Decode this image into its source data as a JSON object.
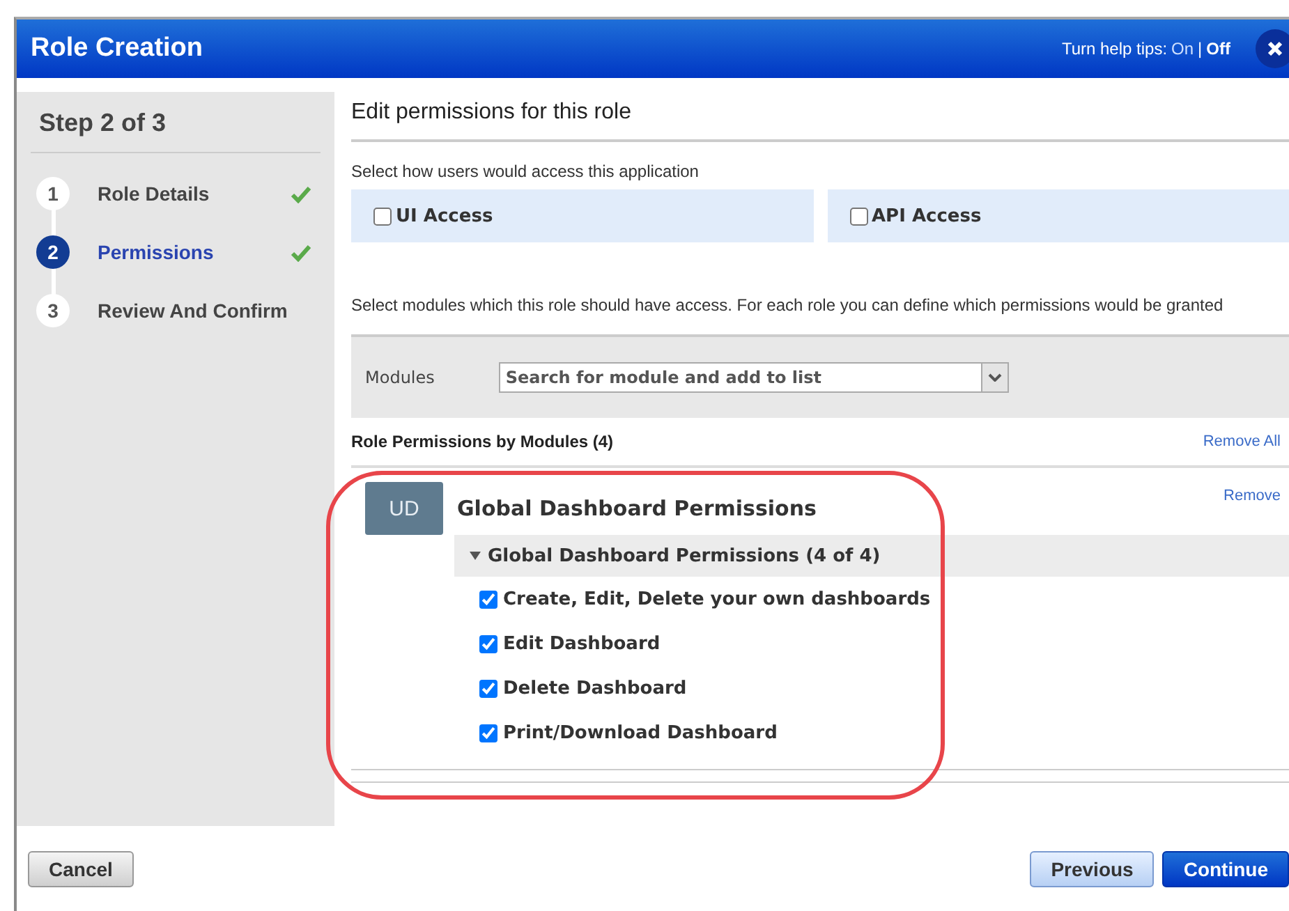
{
  "window": {
    "title": "Role Creation"
  },
  "help_tips": {
    "label": "Turn help tips:",
    "separator": "|",
    "options": [
      {
        "label": "On",
        "selected": false
      },
      {
        "label": "Off",
        "selected": true
      }
    ]
  },
  "sidebar": {
    "title": "Step 2 of 3",
    "steps": [
      {
        "number": "1",
        "label": "Role Details",
        "selected": false,
        "completed": true
      },
      {
        "number": "2",
        "label": "Permissions",
        "selected": true,
        "completed": true
      },
      {
        "number": "3",
        "label": "Review And Confirm",
        "selected": false,
        "completed": false
      }
    ]
  },
  "content": {
    "heading": "Edit permissions for this role",
    "access_prompt": "Select how users would access this application",
    "access_options": [
      {
        "label": "UI Access",
        "checked": false
      },
      {
        "label": "API Access",
        "checked": false
      }
    ],
    "modules_prompt": "Select modules which this role should have access. For each role you can define which permissions would be granted",
    "modules_label": "Modules",
    "modules_placeholder": "Search for module and add to list",
    "permissions_title": "Role Permissions by Modules (4)",
    "remove_all": "Remove All",
    "module": {
      "initials": "UD",
      "name": "Global Dashboard Permissions",
      "remove": "Remove",
      "highlighted": true,
      "group": {
        "title": "Global Dashboard Permissions (4 of 4)",
        "expanded": true,
        "items": [
          {
            "label": "Create, Edit, Delete your own dashboards",
            "checked": true
          },
          {
            "label": "Edit Dashboard",
            "checked": true
          },
          {
            "label": "Delete Dashboard",
            "checked": true
          },
          {
            "label": "Print/Download Dashboard",
            "checked": true
          }
        ]
      }
    }
  },
  "footer": {
    "cancel": "Cancel",
    "previous": "Previous",
    "continue": "Continue"
  }
}
